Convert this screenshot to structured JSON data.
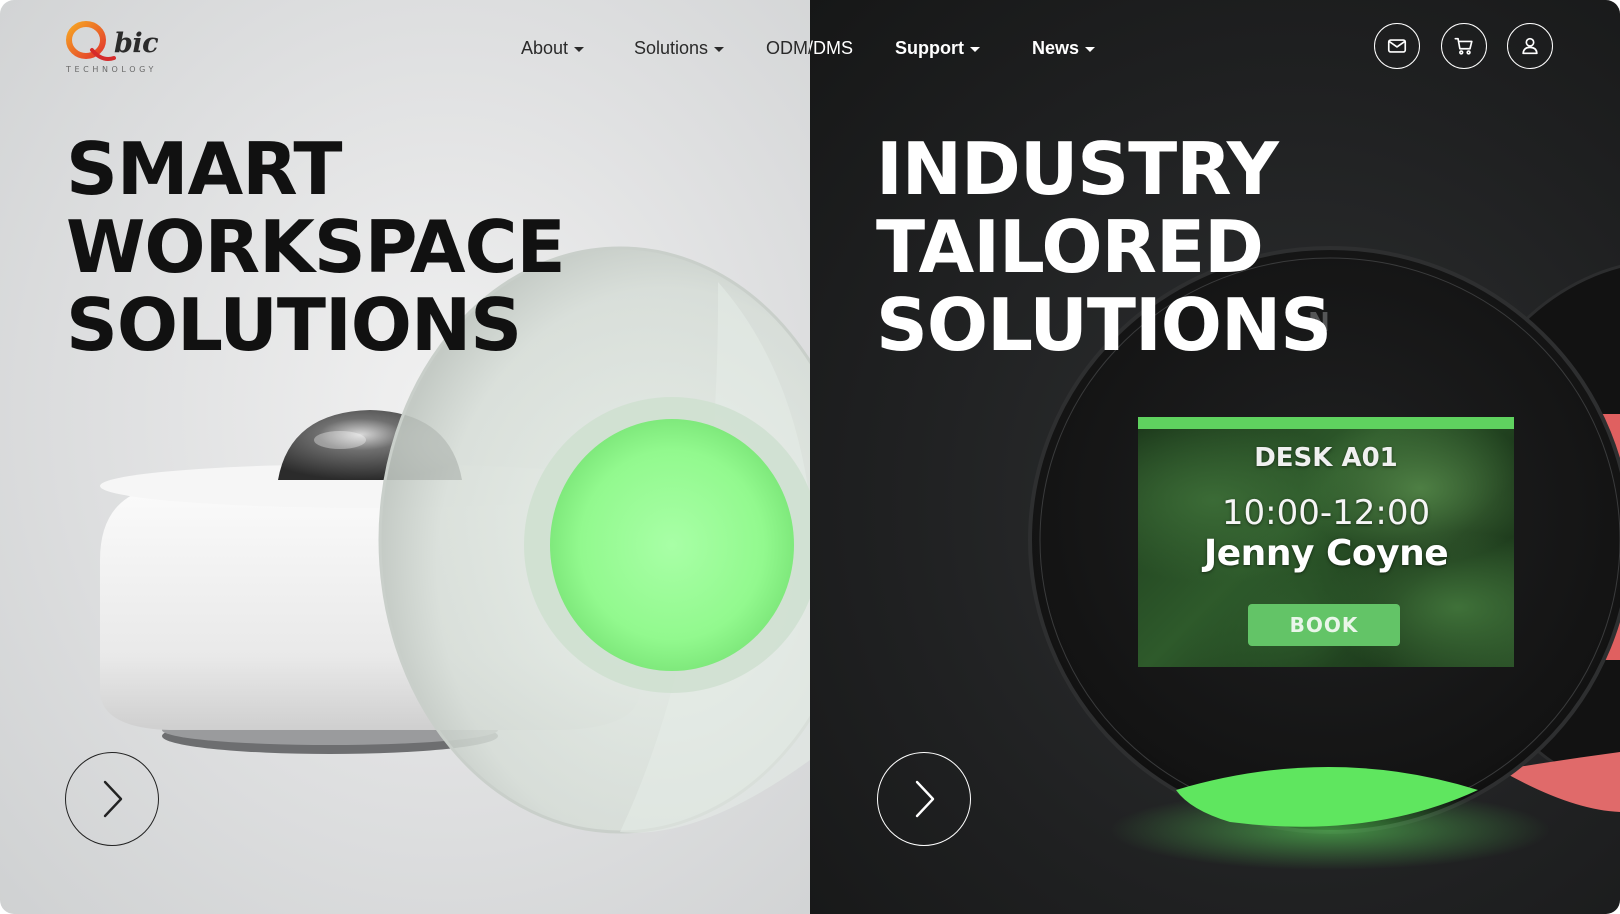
{
  "brand": {
    "logo_letter": "Q",
    "logo_text": "bic",
    "logo_sub": "TECHNOLOGY"
  },
  "nav": {
    "about": "About",
    "solutions": "Solutions",
    "odm": "ODM/DMS",
    "support": "Support",
    "news": "News"
  },
  "header_icons": [
    "mail-icon",
    "cart-icon",
    "user-icon"
  ],
  "slides": {
    "left": {
      "headline": [
        "SMART",
        "WORKSPACE",
        "SOLUTIONS"
      ]
    },
    "right": {
      "headline": [
        "INDUSTRY",
        "TAILORED",
        "SOLUTIONS"
      ],
      "device_screen": {
        "desk": "DESK A01",
        "time": "10:00-12:00",
        "name": "Jenny Coyne",
        "book_label": "BOOK"
      }
    }
  },
  "colors": {
    "accent_green": "#5fd25f",
    "status_red": "#e06060",
    "left_bg": "#dedfe0",
    "right_bg": "#1f2021"
  }
}
